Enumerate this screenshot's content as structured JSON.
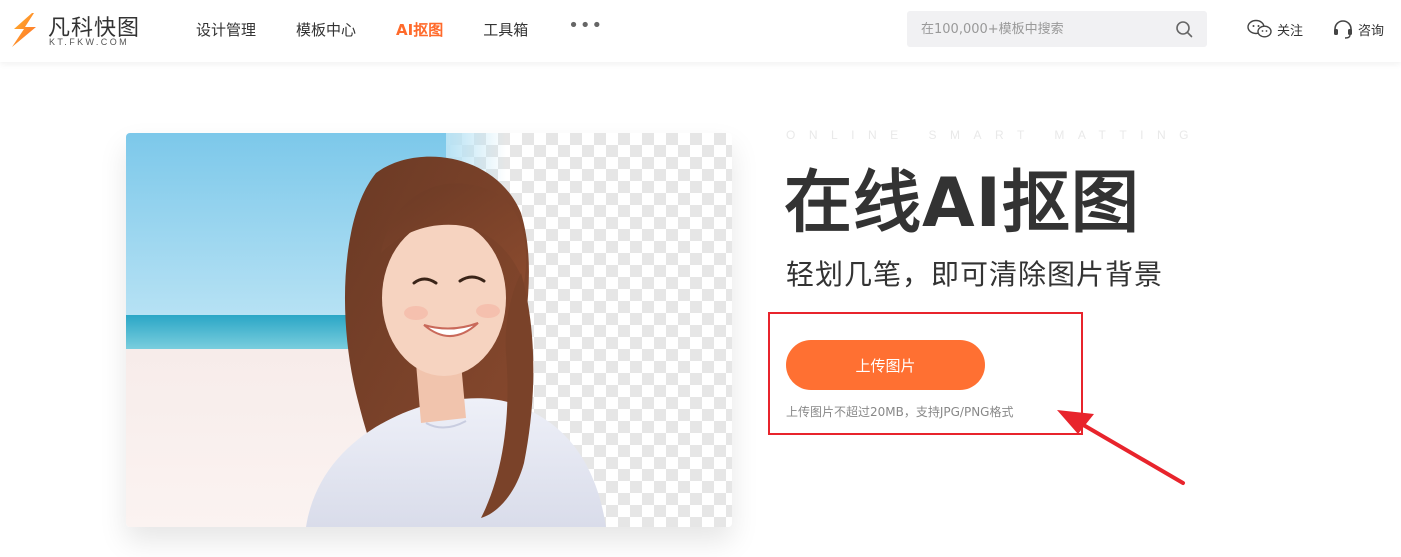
{
  "header": {
    "logo_name": "凡科快图",
    "logo_sub": "KT.FKW.COM",
    "nav": [
      {
        "label": "设计管理",
        "active": false
      },
      {
        "label": "模板中心",
        "active": false
      },
      {
        "label": "AI抠图",
        "active": true
      },
      {
        "label": "工具箱",
        "active": false
      }
    ],
    "more_label": "•••",
    "search": {
      "placeholder": "在100,000+模板中搜索"
    },
    "follow_label": "关注",
    "consult_label": "咨询"
  },
  "hero": {
    "tagline_en": "ONLINE SMART MATTING",
    "title": "在线AI抠图",
    "subtitle": "轻划几笔，即可清除图片背景",
    "upload_label": "上传图片",
    "hint": "上传图片不超过20MB，支持JPG/PNG格式"
  },
  "colors": {
    "accent": "#ff7032",
    "active_nav": "#ff6a2b",
    "highlight": "#e8242c"
  },
  "icons": [
    "logo-mark-icon",
    "search-icon",
    "wechat-icon",
    "headset-icon",
    "annotation-arrow-icon"
  ]
}
